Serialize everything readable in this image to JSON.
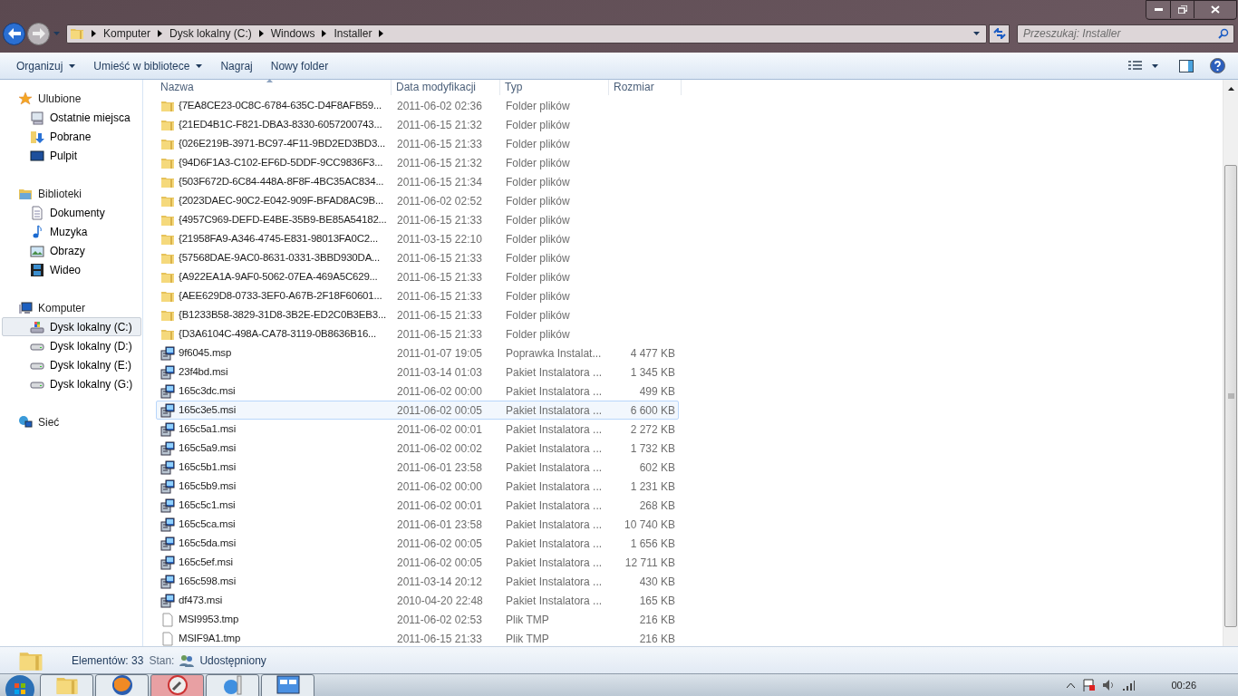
{
  "address": {
    "breadcrumb": [
      "Komputer",
      "Dysk lokalny (C:)",
      "Windows",
      "Installer"
    ]
  },
  "search": {
    "placeholder": "Przeszukaj: Installer"
  },
  "toolbar": [
    {
      "label": "Organizuj",
      "dropdown": true
    },
    {
      "label": "Umieść w bibliotece",
      "dropdown": true
    },
    {
      "label": "Nagraj",
      "dropdown": false
    },
    {
      "label": "Nowy folder",
      "dropdown": false
    }
  ],
  "sidebar": [
    {
      "label": "Ulubione",
      "kind": "star",
      "children": [
        {
          "label": "Ostatnie miejsca",
          "kind": "recent",
          "selected": false
        },
        {
          "label": "Pobrane",
          "kind": "downloads",
          "selected": false
        },
        {
          "label": "Pulpit",
          "kind": "desktop",
          "selected": false
        }
      ]
    },
    {
      "label": "Biblioteki",
      "kind": "libraries",
      "children": [
        {
          "label": "Dokumenty",
          "kind": "document",
          "selected": false
        },
        {
          "label": "Muzyka",
          "kind": "music",
          "selected": false
        },
        {
          "label": "Obrazy",
          "kind": "picture",
          "selected": false
        },
        {
          "label": "Wideo",
          "kind": "video",
          "selected": false
        }
      ]
    },
    {
      "label": "Komputer",
      "kind": "computer",
      "children": [
        {
          "label": "Dysk lokalny (C:)",
          "kind": "system-drive",
          "selected": true
        },
        {
          "label": "Dysk lokalny (D:)",
          "kind": "drive",
          "selected": false
        },
        {
          "label": "Dysk lokalny (E:)",
          "kind": "drive",
          "selected": false
        },
        {
          "label": "Dysk lokalny (G:)",
          "kind": "drive",
          "selected": false
        }
      ]
    },
    {
      "label": "Sieć",
      "kind": "network"
    }
  ],
  "table": {
    "columns": [
      {
        "label": "Nazwa",
        "sorted": true
      },
      {
        "label": "Data modyfikacji",
        "sorted": false
      },
      {
        "label": "Typ",
        "sorted": false
      },
      {
        "label": "Rozmiar",
        "sorted": false
      }
    ],
    "rows": [
      {
        "kind": "folder",
        "name": "{7EA8CE23-0C8C-6784-635C-D4F8AFB59...",
        "date": "2011-06-02 02:36",
        "type": "Folder plików",
        "selected": false
      },
      {
        "kind": "folder",
        "name": "{21ED4B1C-F821-DBA3-8330-6057200743...",
        "date": "2011-06-15 21:32",
        "type": "Folder plików",
        "selected": false
      },
      {
        "kind": "folder",
        "name": "{026E219B-3971-BC97-4F11-9BD2ED3BD3...",
        "date": "2011-06-15 21:33",
        "type": "Folder plików",
        "selected": false
      },
      {
        "kind": "folder",
        "name": "{94D6F1A3-C102-EF6D-5DDF-9CC9836F3...",
        "date": "2011-06-15 21:32",
        "type": "Folder plików",
        "selected": false
      },
      {
        "kind": "folder",
        "name": "{503F672D-6C84-448A-8F8F-4BC35AC834...",
        "date": "2011-06-15 21:34",
        "type": "Folder plików",
        "selected": false
      },
      {
        "kind": "folder",
        "name": "{2023DAEC-90C2-E042-909F-BFAD8AC9B...",
        "date": "2011-06-02 02:52",
        "type": "Folder plików",
        "selected": false
      },
      {
        "kind": "folder",
        "name": "{4957C969-DEFD-E4BE-35B9-BE85A54182...",
        "date": "2011-06-15 21:33",
        "type": "Folder plików",
        "selected": false
      },
      {
        "kind": "folder",
        "name": "{21958FA9-A346-4745-E831-98013FA0C2...",
        "date": "2011-03-15 22:10",
        "type": "Folder plików",
        "selected": false
      },
      {
        "kind": "folder",
        "name": "{57568DAE-9AC0-8631-0331-3BBD930DA...",
        "date": "2011-06-15 21:33",
        "type": "Folder plików",
        "selected": false
      },
      {
        "kind": "folder",
        "name": "{A922EA1A-9AF0-5062-07EA-469A5C629...",
        "date": "2011-06-15 21:33",
        "type": "Folder plików",
        "selected": false
      },
      {
        "kind": "folder",
        "name": "{AEE629D8-0733-3EF0-A67B-2F18F60601...",
        "date": "2011-06-15 21:33",
        "type": "Folder plików",
        "selected": false
      },
      {
        "kind": "folder",
        "name": "{B1233B58-3829-31D8-3B2E-ED2C0B3EB3...",
        "date": "2011-06-15 21:33",
        "type": "Folder plików",
        "selected": false
      },
      {
        "kind": "folder",
        "name": "{D3A6104C-498A-CA78-3119-0B8636B16...",
        "date": "2011-06-15 21:33",
        "type": "Folder plików",
        "selected": false
      },
      {
        "kind": "installer",
        "name": "9f6045.msp",
        "date": "2011-01-07 19:05",
        "type": "Poprawka Instalat...",
        "size": "4 477 KB",
        "selected": false
      },
      {
        "kind": "installer",
        "name": "23f4bd.msi",
        "date": "2011-03-14 01:03",
        "type": "Pakiet Instalatora ...",
        "size": "1 345 KB",
        "selected": false
      },
      {
        "kind": "installer",
        "name": "165c3dc.msi",
        "date": "2011-06-02 00:00",
        "type": "Pakiet Instalatora ...",
        "size": "499 KB",
        "selected": false
      },
      {
        "kind": "installer",
        "name": "165c3e5.msi",
        "date": "2011-06-02 00:05",
        "type": "Pakiet Instalatora ...",
        "size": "6 600 KB",
        "selected": true
      },
      {
        "kind": "installer",
        "name": "165c5a1.msi",
        "date": "2011-06-02 00:01",
        "type": "Pakiet Instalatora ...",
        "size": "2 272 KB",
        "selected": false
      },
      {
        "kind": "installer",
        "name": "165c5a9.msi",
        "date": "2011-06-02 00:02",
        "type": "Pakiet Instalatora ...",
        "size": "1 732 KB",
        "selected": false
      },
      {
        "kind": "installer",
        "name": "165c5b1.msi",
        "date": "2011-06-01 23:58",
        "type": "Pakiet Instalatora ...",
        "size": "602 KB",
        "selected": false
      },
      {
        "kind": "installer",
        "name": "165c5b9.msi",
        "date": "2011-06-02 00:00",
        "type": "Pakiet Instalatora ...",
        "size": "1 231 KB",
        "selected": false
      },
      {
        "kind": "installer",
        "name": "165c5c1.msi",
        "date": "2011-06-02 00:01",
        "type": "Pakiet Instalatora ...",
        "size": "268 KB",
        "selected": false
      },
      {
        "kind": "installer",
        "name": "165c5ca.msi",
        "date": "2011-06-01 23:58",
        "type": "Pakiet Instalatora ...",
        "size": "10 740 KB",
        "selected": false
      },
      {
        "kind": "installer",
        "name": "165c5da.msi",
        "date": "2011-06-02 00:05",
        "type": "Pakiet Instalatora ...",
        "size": "1 656 KB",
        "selected": false
      },
      {
        "kind": "installer",
        "name": "165c5ef.msi",
        "date": "2011-06-02 00:05",
        "type": "Pakiet Instalatora ...",
        "size": "12 711 KB",
        "selected": false
      },
      {
        "kind": "installer",
        "name": "165c598.msi",
        "date": "2011-03-14 20:12",
        "type": "Pakiet Instalatora ...",
        "size": "430 KB",
        "selected": false
      },
      {
        "kind": "installer",
        "name": "df473.msi",
        "date": "2010-04-20 22:48",
        "type": "Pakiet Instalatora ...",
        "size": "165 KB",
        "selected": false
      },
      {
        "kind": "file",
        "name": "MSI9953.tmp",
        "date": "2011-06-02 02:53",
        "type": "Plik TMP",
        "size": "216 KB",
        "selected": false
      },
      {
        "kind": "file",
        "name": "MSIF9A1.tmp",
        "date": "2011-06-15 21:33",
        "type": "Plik TMP",
        "size": "216 KB",
        "selected": false
      }
    ]
  },
  "status_bar": {
    "count": "Elementów: 33",
    "state_label": "Stan:",
    "state_value": "Udostępniony"
  },
  "taskbar": {
    "apps": [
      {
        "kind": "folder",
        "active": false
      },
      {
        "kind": "browser",
        "active": false
      },
      {
        "kind": "tool",
        "active": true
      },
      {
        "kind": "web",
        "active": false
      },
      {
        "kind": "panel",
        "active": false
      }
    ],
    "clock": "00:26"
  }
}
